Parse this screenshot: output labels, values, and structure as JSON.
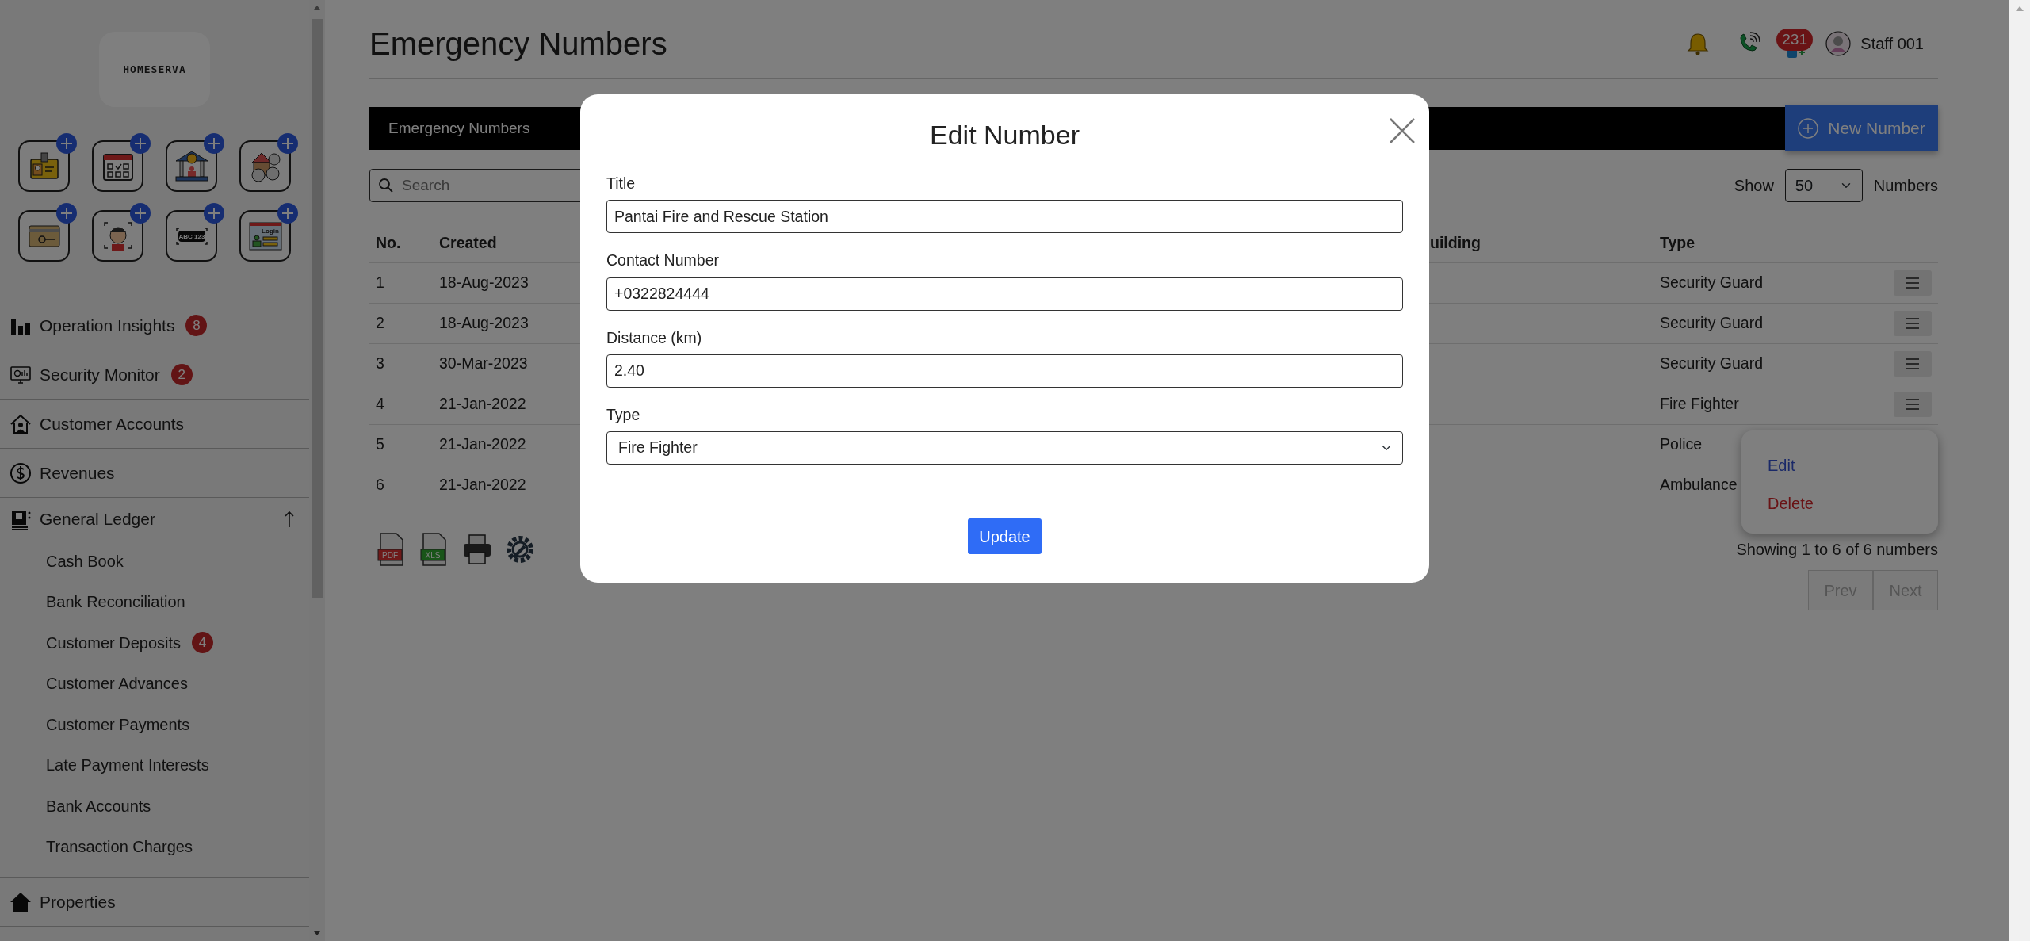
{
  "sidebar": {
    "logo": "HOMESERVA",
    "quick_add": [
      {
        "kind": "id-card"
      },
      {
        "kind": "calendar"
      },
      {
        "kind": "bank"
      },
      {
        "kind": "house-tools"
      },
      {
        "kind": "key-card"
      },
      {
        "kind": "face"
      },
      {
        "kind": "plate",
        "label": "ABC 123"
      },
      {
        "kind": "login",
        "label": "Login"
      }
    ],
    "nav": [
      {
        "kind": "chart",
        "label": "Operation Insights",
        "badge": "8"
      },
      {
        "kind": "monitor",
        "label": "Security Monitor",
        "badge": "2"
      },
      {
        "kind": "house-person",
        "label": "Customer Accounts"
      },
      {
        "kind": "dollar",
        "label": "Revenues"
      },
      {
        "kind": "ledger",
        "label": "General Ledger",
        "expanded": true,
        "children": [
          {
            "label": "Cash Book"
          },
          {
            "label": "Bank Reconciliation"
          },
          {
            "label": "Customer Deposits",
            "badge": "4"
          },
          {
            "label": "Customer Advances"
          },
          {
            "label": "Customer Payments"
          },
          {
            "label": "Late Payment Interests"
          },
          {
            "label": "Bank Accounts"
          },
          {
            "label": "Transaction Charges"
          }
        ]
      },
      {
        "kind": "house",
        "label": "Properties"
      }
    ]
  },
  "header": {
    "title": "Emergency Numbers",
    "messages_badge": "231",
    "user": "Staff 001"
  },
  "toolbar": {
    "tab": "Emergency Numbers",
    "new_button": "New Number"
  },
  "search": {
    "placeholder": "Search"
  },
  "page_size": {
    "label": "Show",
    "value": "50",
    "suffix": "Numbers"
  },
  "table": {
    "columns": [
      "No.",
      "Created",
      "uilding",
      "Type"
    ],
    "rows": [
      {
        "no": "1",
        "created": "18-Aug-2023",
        "type": "Security Guard",
        "menu_button": true
      },
      {
        "no": "2",
        "created": "18-Aug-2023",
        "type": "Security Guard",
        "menu_button": true
      },
      {
        "no": "3",
        "created": "30-Mar-2023",
        "type": "Security Guard",
        "menu_button": true
      },
      {
        "no": "4",
        "created": "21-Jan-2022",
        "type": "Fire Fighter",
        "menu_button": true
      },
      {
        "no": "5",
        "created": "21-Jan-2022",
        "type": "Police",
        "menu_button": false
      },
      {
        "no": "6",
        "created": "21-Jan-2022",
        "type": "Ambulance",
        "menu_button": false
      }
    ]
  },
  "row_menu": {
    "items": [
      {
        "kind": "edit",
        "label": "Edit"
      },
      {
        "kind": "delete",
        "label": "Delete"
      }
    ]
  },
  "exports": [
    {
      "kind": "pdf",
      "label": "PDF"
    },
    {
      "kind": "xls",
      "label": "XLS"
    },
    {
      "kind": "print"
    },
    {
      "kind": "settings"
    }
  ],
  "summary": "Showing 1 to 6 of 6 numbers",
  "pagination": [
    {
      "label": "Prev",
      "disabled": true
    },
    {
      "label": "Next",
      "disabled": true
    }
  ],
  "modal": {
    "title": "Edit Number",
    "fields": [
      {
        "kind": "text",
        "label": "Title",
        "value": "Pantai Fire and Rescue Station"
      },
      {
        "kind": "text",
        "label": "Contact Number",
        "value": "+0322824444"
      },
      {
        "kind": "text",
        "label": "Distance (km)",
        "value": "2.40"
      },
      {
        "kind": "select",
        "label": "Type",
        "value": "Fire Fighter"
      }
    ],
    "submit": "Update"
  }
}
